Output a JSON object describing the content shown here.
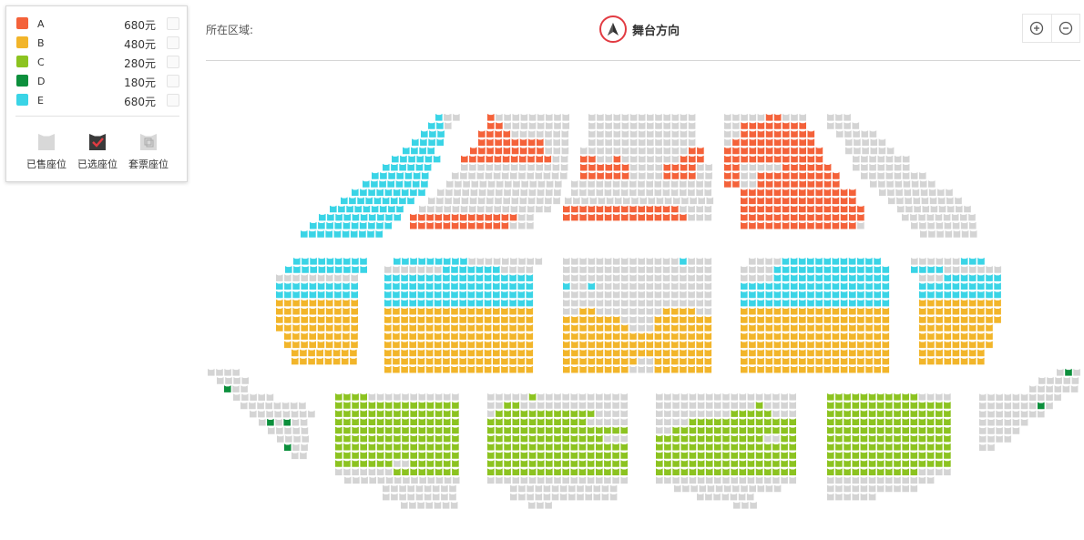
{
  "legend": {
    "prices": [
      {
        "name": "A",
        "price": "680元",
        "color": "#f4623a"
      },
      {
        "name": "B",
        "price": "480元",
        "color": "#f2b52a"
      },
      {
        "name": "C",
        "price": "280元",
        "color": "#8cc320"
      },
      {
        "name": "D",
        "price": "180元",
        "color": "#0c8f3c"
      },
      {
        "name": "E",
        "price": "680元",
        "color": "#3ad4e6"
      }
    ],
    "status": [
      {
        "label": "已售座位",
        "icon": "sold-seat-icon"
      },
      {
        "label": "已选座位",
        "icon": "selected-seat-icon"
      },
      {
        "label": "套票座位",
        "icon": "package-seat-icon"
      }
    ]
  },
  "header": {
    "area_label": "所在区域:",
    "stage_label": "舞台方向",
    "stage_icon": "stage-direction-icon",
    "zoom_in_icon": "zoom-in-icon",
    "zoom_out_icon": "zoom-out-icon"
  },
  "colors": {
    "sold": "#d4d4d4",
    "A": "#f4623a",
    "B": "#f2b52a",
    "C": "#8cc320",
    "D": "#0c8f3c",
    "E": "#3ad4e6"
  }
}
